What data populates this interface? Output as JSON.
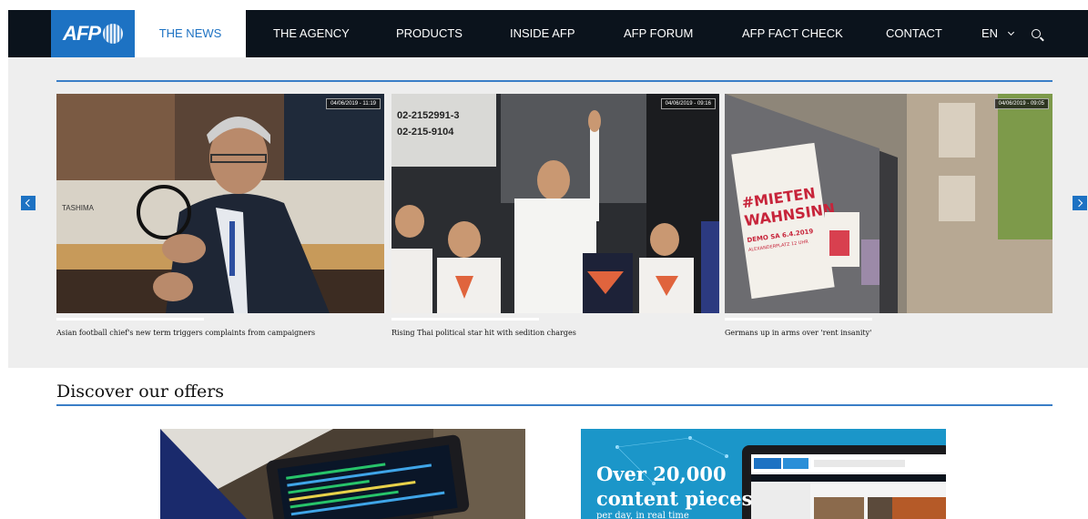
{
  "nav": {
    "logo": "AFP",
    "items": [
      {
        "label": "THE NEWS",
        "active": true
      },
      {
        "label": "THE AGENCY"
      },
      {
        "label": "PRODUCTS"
      },
      {
        "label": "INSIDE AFP"
      },
      {
        "label": "AFP FORUM"
      },
      {
        "label": "AFP FACT CHECK"
      },
      {
        "label": "CONTACT"
      }
    ],
    "language": "EN"
  },
  "carousel": {
    "slides": [
      {
        "timestamp": "04/06/2019 - 11:19",
        "caption": "Asian football chief's new term triggers complaints from campaigners"
      },
      {
        "timestamp": "04/06/2019 - 09:16",
        "caption": "Rising Thai political star hit with sedition charges"
      },
      {
        "timestamp": "04/06/2019 - 09:05",
        "caption": "Germans up in arms over 'rent insanity'"
      }
    ],
    "slide_text": {
      "sign_tashima": "TASHIMA",
      "sign_thai_phone1": "02-2152991-3",
      "sign_thai_phone2": "02-215-9104",
      "poster_line1": "#MIETEN",
      "poster_line2": "WAHNSINN",
      "poster_line3": "DEMO SA 6.4.2019",
      "poster_line4": "ALEXANDERPLATZ 12 UHR"
    }
  },
  "offers": {
    "title": "Discover our offers",
    "items": [
      {
        "heading": "",
        "sub": ""
      },
      {
        "heading_line1": "Over 20,000",
        "heading_line2": "content pieces",
        "sub": "per day, in real time"
      }
    ]
  },
  "colors": {
    "nav_bg": "#0b131c",
    "accent": "#1d72c3",
    "band_bg": "#eeeeee"
  }
}
